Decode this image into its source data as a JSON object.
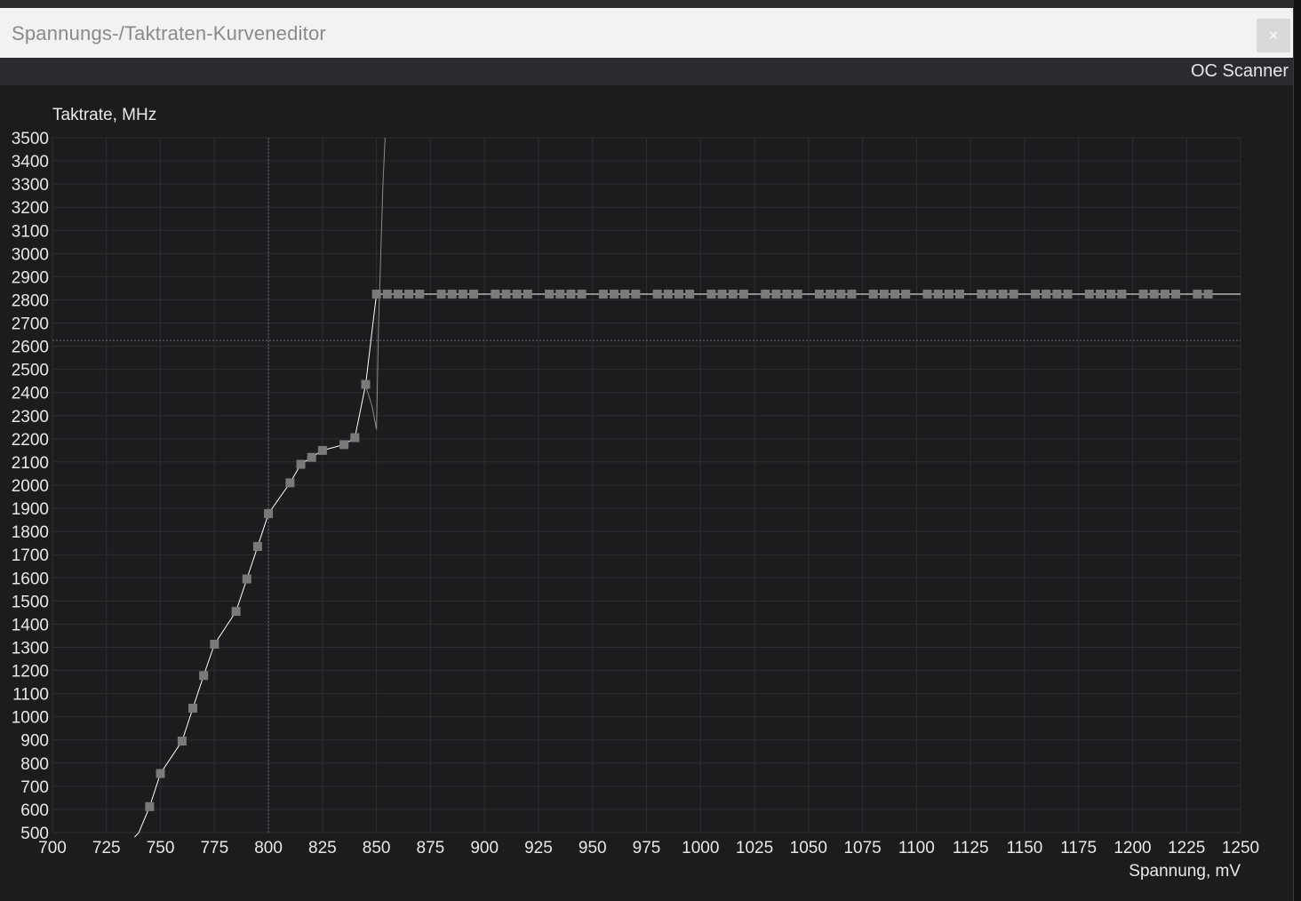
{
  "window": {
    "title": "Spannungs-/Taktraten-Kurveneditor",
    "close_label": "×"
  },
  "toolbar": {
    "oc_scanner_label": "OC Scanner"
  },
  "colors": {
    "background": "#1c1c1f",
    "grid": "#2e2e32",
    "curve": "#ffffff",
    "point": "#7a7a7a",
    "text": "#e8e8e8"
  },
  "chart_data": {
    "type": "line",
    "xlabel": "Spannung, mV",
    "ylabel": "Taktrate, MHz",
    "xlim": [
      700,
      1250
    ],
    "ylim": [
      500,
      3500
    ],
    "xticks": [
      700,
      725,
      750,
      775,
      800,
      825,
      850,
      875,
      900,
      925,
      950,
      975,
      1000,
      1025,
      1050,
      1075,
      1100,
      1125,
      1150,
      1175,
      1200,
      1225,
      1250
    ],
    "yticks": [
      500,
      600,
      700,
      800,
      900,
      1000,
      1100,
      1200,
      1300,
      1400,
      1500,
      1600,
      1700,
      1800,
      1900,
      2000,
      2100,
      2200,
      2300,
      2400,
      2500,
      2600,
      2700,
      2800,
      2900,
      3000,
      3100,
      3200,
      3300,
      3400,
      3500
    ],
    "grid": true,
    "cursor_x": 800,
    "limit_y": 2625,
    "series": [
      {
        "line_x": [
          738,
          740,
          745,
          750,
          760,
          765,
          770,
          775,
          785,
          790,
          795,
          800,
          810,
          815,
          820,
          825,
          835,
          840,
          845,
          850,
          1250
        ],
        "line_y": [
          480,
          500,
          612,
          755,
          895,
          1037,
          1178,
          1313,
          1455,
          1595,
          1735,
          1877,
          2010,
          2090,
          2120,
          2150,
          2175,
          2205,
          2435,
          2825,
          2825
        ],
        "points_x": [
          745,
          750,
          760,
          765,
          770,
          775,
          785,
          790,
          795,
          800,
          810,
          815,
          820,
          825,
          835,
          840,
          845,
          850,
          855,
          860,
          865,
          870,
          880,
          885,
          890,
          895,
          905,
          910,
          915,
          920,
          930,
          935,
          940,
          945,
          955,
          960,
          965,
          970,
          980,
          985,
          990,
          995,
          1005,
          1010,
          1015,
          1020,
          1030,
          1035,
          1040,
          1045,
          1055,
          1060,
          1065,
          1070,
          1080,
          1085,
          1090,
          1095,
          1105,
          1110,
          1115,
          1120,
          1130,
          1135,
          1140,
          1145,
          1155,
          1160,
          1165,
          1170,
          1180,
          1185,
          1190,
          1195,
          1205,
          1210,
          1215,
          1220,
          1230,
          1235
        ],
        "points_y": [
          612,
          755,
          895,
          1037,
          1178,
          1313,
          1455,
          1595,
          1735,
          1877,
          2010,
          2090,
          2120,
          2150,
          2175,
          2205,
          2435,
          2825,
          2825,
          2825,
          2825,
          2825,
          2825,
          2825,
          2825,
          2825,
          2825,
          2825,
          2825,
          2825,
          2825,
          2825,
          2825,
          2825,
          2825,
          2825,
          2825,
          2825,
          2825,
          2825,
          2825,
          2825,
          2825,
          2825,
          2825,
          2825,
          2825,
          2825,
          2825,
          2825,
          2825,
          2825,
          2825,
          2825,
          2825,
          2825,
          2825,
          2825,
          2825,
          2825,
          2825,
          2825,
          2825,
          2825,
          2825,
          2825,
          2825,
          2825,
          2825,
          2825,
          2825,
          2825,
          2825,
          2825,
          2825,
          2825,
          2825,
          2825,
          2825,
          2825
        ]
      },
      {
        "line_x": [
          845,
          848,
          850,
          851,
          852,
          853,
          854
        ],
        "line_y": [
          2430,
          2340,
          2240,
          2700,
          3000,
          3300,
          3500
        ]
      }
    ]
  }
}
